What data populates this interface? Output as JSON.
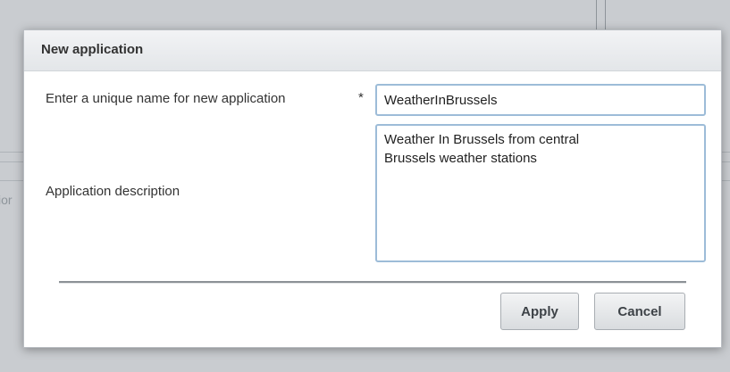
{
  "background": {
    "tab_fragment": "ior"
  },
  "dialog": {
    "title": "New application",
    "name_label": "Enter a unique name for new application",
    "required_marker": "*",
    "name_value": "WeatherInBrussels",
    "description_label": "Application description",
    "description_value": "Weather In Brussels from central\nBrussels weather stations",
    "apply_label": "Apply",
    "cancel_label": "Cancel"
  }
}
